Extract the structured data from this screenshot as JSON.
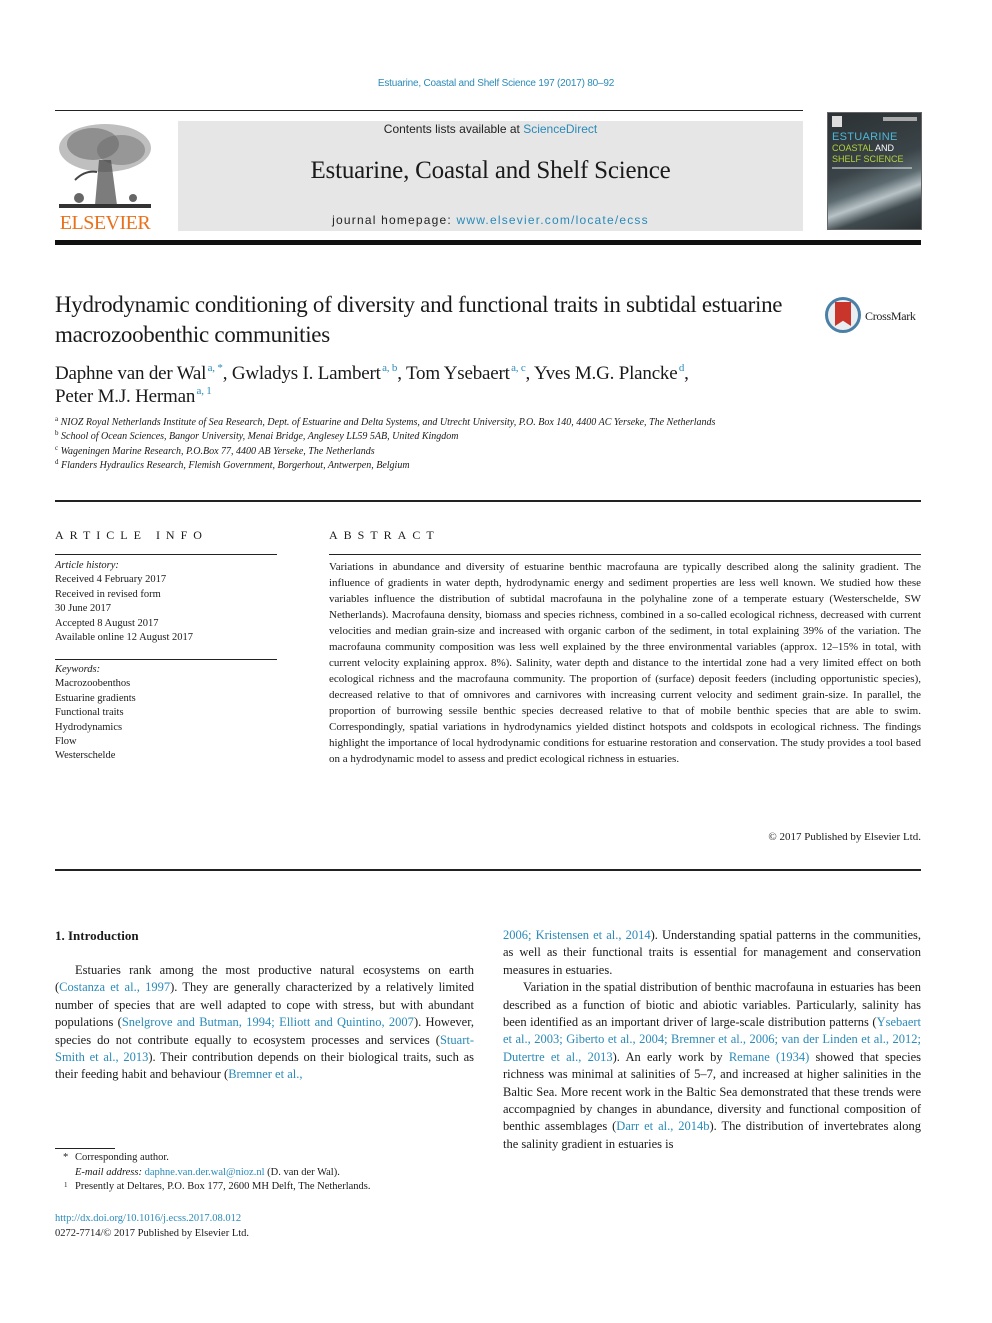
{
  "journal_ref": "Estuarine, Coastal and Shelf Science 197 (2017) 80–92",
  "header": {
    "publisher_logo_text": "ELSEVIER",
    "contents_prefix": "Contents lists available at ",
    "contents_link": "ScienceDirect",
    "journal_title": "Estuarine, Coastal and Shelf Science",
    "homepage_prefix": "journal homepage: ",
    "homepage_link": "www.elsevier.com/locate/ecss",
    "cover": {
      "line1": "ESTUARINE",
      "line2a": "COASTAL",
      "line2b": " AND",
      "line3": "SHELF SCIENCE"
    },
    "colors": {
      "link": "#2a8ab8",
      "elsevier_orange": "#e9711c",
      "banner_gray": "#e6e6e6"
    }
  },
  "article": {
    "title": "Hydrodynamic conditioning of diversity and functional traits in subtidal estuarine macrozoobenthic communities",
    "crossmark_label": "CrossMark",
    "authors": [
      {
        "name": "Daphne van der Wal",
        "sup": "a, *",
        "sep": ", "
      },
      {
        "name": "Gwladys I. Lambert",
        "sup": "a, b",
        "sep": ", "
      },
      {
        "name": "Tom Ysebaert",
        "sup": "a, c",
        "sep": ", "
      },
      {
        "name": "Yves M.G. Plancke",
        "sup": "d",
        "sep": ","
      },
      {
        "name": "Peter M.J. Herman",
        "sup": "a, 1",
        "sep": ""
      }
    ],
    "affiliations": [
      {
        "key": "a",
        "text": "NIOZ Royal Netherlands Institute of Sea Research, Dept. of Estuarine and Delta Systems, and Utrecht University, P.O. Box 140, 4400 AC Yerseke, The Netherlands"
      },
      {
        "key": "b",
        "text": "School of Ocean Sciences, Bangor University, Menai Bridge, Anglesey LL59 5AB, United Kingdom"
      },
      {
        "key": "c",
        "text": "Wageningen Marine Research, P.O.Box 77, 4400 AB Yerseke, The Netherlands"
      },
      {
        "key": "d",
        "text": "Flanders Hydraulics Research, Flemish Government, Borgerhout, Antwerpen, Belgium"
      }
    ]
  },
  "article_info": {
    "heading": "ARTICLE INFO",
    "history_label": "Article history:",
    "history": [
      "Received 4 February 2017",
      "Received in revised form",
      "30 June 2017",
      "Accepted 8 August 2017",
      "Available online 12 August 2017"
    ],
    "keywords_label": "Keywords:",
    "keywords": [
      "Macrozoobenthos",
      "Estuarine gradients",
      "Functional traits",
      "Hydrodynamics",
      "Flow",
      "Westerschelde"
    ]
  },
  "abstract": {
    "heading": "ABSTRACT",
    "text": "Variations in abundance and diversity of estuarine benthic macrofauna are typically described along the salinity gradient. The influence of gradients in water depth, hydrodynamic energy and sediment prop­erties are less well known. We studied how these variables influence the distribution of subtidal mac­rofauna in the polyhaline zone of a temperate estuary (Westerschelde, SW Netherlands). Macrofauna density, biomass and species richness, combined in a so-called ecological richness, decreased with current velocities and median grain-size and increased with organic carbon of the sediment, in total explaining 39% of the variation. The macrofauna community composition was less well explained by the three environmental variables (approx. 12–15% in total, with current velocity explaining approx. 8%). Salinity, water depth and distance to the intertidal zone had a very limited effect on both ecological richness and the macrofauna community. The proportion of (surface) deposit feeders (including opportunistic species), decreased relative to that of omnivores and carnivores with increasing current velocity and sediment grain-size. In parallel, the proportion of burrowing sessile benthic species decreased relative to that of mobile benthic species that are able to swim. Correspondingly, spatial variations in hydrodynamics yielded distinct hotspots and coldspots in ecological richness. The findings highlight the importance of local hydrodynamic conditions for estuarine restoration and conservation. The study provides a tool based on a hydrodynamic model to assess and predict ecological richness in estuaries.",
    "copyright": "© 2017 Published by Elsevier Ltd."
  },
  "introduction": {
    "heading": "1.  Introduction",
    "left_para": [
      {
        "t": "Estuaries rank among the most productive natural ecosystems on earth ("
      },
      {
        "link": "Costanza et al., 1997"
      },
      {
        "t": "). They are generally characterized by a relatively limited number of species that are well adapted to cope with stress, but with abundant populations ("
      },
      {
        "link": "Snelgrove and Butman, 1994; Elliott and Quintino, 2007"
      },
      {
        "t": "). However, species do not contribute equally to ecosystem processes and services ("
      },
      {
        "link": "Stuart-Smith et al., 2013"
      },
      {
        "t": "). Their contribution depends on their biological traits, such as their feeding habit and behaviour ("
      },
      {
        "link": "Bremner et al.,"
      }
    ],
    "right_para1": [
      {
        "link": "2006; Kristensen et al., 2014"
      },
      {
        "t": "). Understanding spatial patterns in the communities, as well as their functional traits is essential for management and conservation measures in estuaries."
      }
    ],
    "right_para2": [
      {
        "t": "Variation in the spatial distribution of benthic macrofauna in estuaries has been described as a function of biotic and abiotic variables. Particularly, salinity has been identified as an important driver of large-scale distribution patterns ("
      },
      {
        "link": "Ysebaert et al., 2003; Giberto et al., 2004; Bremner et al., 2006; van der Linden et al., 2012; Dutertre et al., 2013"
      },
      {
        "t": "). An early work by "
      },
      {
        "link": "Remane (1934)"
      },
      {
        "t": " showed that species richness was minimal at salinities of 5–7, and increased at higher salinities in the Baltic Sea. More recent work in the Baltic Sea demonstrated that these trends were accompagnied by changes in abundance, diversity and functional composition of benthic assemblages ("
      },
      {
        "link": "Darr et al., 2014b"
      },
      {
        "t": "). The dis­tribution of invertebrates along the salinity gradient in estuaries is"
      }
    ]
  },
  "footnotes": {
    "corresponding_mark": "*",
    "corresponding": "Corresponding author.",
    "email_label": "E-mail address:",
    "email": "daphne.van.der.wal@nioz.nl",
    "email_suffix": " (D. van der Wal).",
    "fn1_mark": "1",
    "fn1": "Presently at Deltares, P.O. Box 177, 2600 MH Delft, The Netherlands."
  },
  "doi": {
    "link": "http://dx.doi.org/10.1016/j.ecss.2017.08.012",
    "issn_line": "0272-7714/© 2017 Published by Elsevier Ltd."
  }
}
